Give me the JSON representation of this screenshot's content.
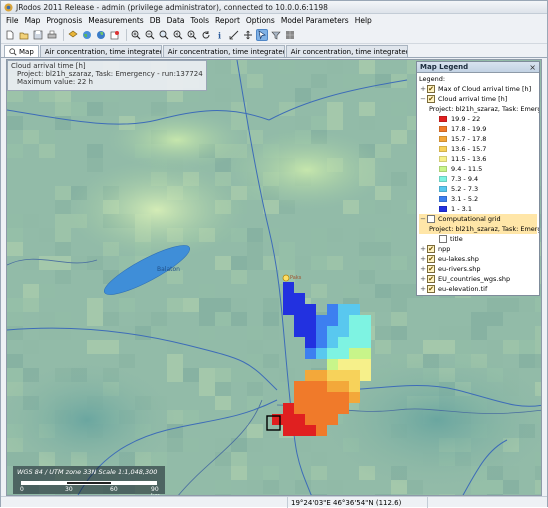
{
  "window": {
    "title": "JRodos 2011 Release - admin (privilege administrator), connected to 10.0.0.6:1198"
  },
  "menu": [
    "File",
    "Map",
    "Prognosis",
    "Measurements",
    "DB",
    "Data",
    "Tools",
    "Report",
    "Options",
    "Model Parameters",
    "Help"
  ],
  "toolbar_icons": [
    "new-icon",
    "open-icon",
    "save-icon",
    "print-icon",
    "layer-add-icon",
    "globe-icon",
    "globe-web-icon",
    "export-icon",
    "zoom-in-icon",
    "zoom-out-icon",
    "zoom-extent-icon",
    "zoom-prev-icon",
    "zoom-next-icon",
    "refresh-icon",
    "identify-icon",
    "measure-icon",
    "pan-icon",
    "select-icon",
    "filter-icon",
    "grid-icon"
  ],
  "tabs": [
    {
      "label": "Map",
      "selected": true
    },
    {
      "label": "Air concentration, time integrated n ...",
      "selected": false
    },
    {
      "label": "Air concentration, time integrated n ...",
      "selected": false
    },
    {
      "label": "Air concentration, time integrated n ...",
      "selected": false
    }
  ],
  "info_panel": {
    "title": "Cloud arrival time [h]",
    "project": "Project: bl21h_szaraz, Task: Emergency - run:1377242142983",
    "max": "Maximum value: 22 h"
  },
  "map_labels": {
    "lake": "Balaton"
  },
  "scale": {
    "text": "WGS 84 / UTM zone 33N    Scale 1:1,048,300",
    "ticks": [
      "0",
      "30",
      "60",
      "90 km"
    ]
  },
  "legend": {
    "title": "Map Legend",
    "close": "×",
    "heading": "Legend:",
    "items": [
      {
        "label": "Max of Cloud arrival time [h]",
        "checked": true
      },
      {
        "label": "Cloud arrival time [h]",
        "checked": true
      },
      {
        "label": "Project: bl21h_szaraz, Task: Emergency"
      }
    ],
    "classes": [
      {
        "label": "19.9 - 22",
        "color": "#e02020"
      },
      {
        "label": "17.8 - 19.9",
        "color": "#f07a2a"
      },
      {
        "label": "15.7 - 17.8",
        "color": "#f3a83a"
      },
      {
        "label": "13.6 - 15.7",
        "color": "#f7d25a"
      },
      {
        "label": "11.5 - 13.6",
        "color": "#f6f08a"
      },
      {
        "label": "9.4 - 11.5",
        "color": "#c8f58a"
      },
      {
        "label": "7.3 - 9.4",
        "color": "#7ef3e2"
      },
      {
        "label": "5.2 - 7.3",
        "color": "#59c8ef"
      },
      {
        "label": "3.1 - 5.2",
        "color": "#3d7ff0"
      },
      {
        "label": "1 - 3.1",
        "color": "#2231e0"
      }
    ],
    "grid": {
      "label": "Computational grid",
      "project": "Project: bl21h_szaraz, Task: Emergency",
      "title": "title"
    },
    "layers": [
      {
        "label": "npp",
        "checked": true
      },
      {
        "label": "eu-lakes.shp",
        "checked": true
      },
      {
        "label": "eu-rivers.shp",
        "checked": true
      },
      {
        "label": "EU_countries_wgs.shp",
        "checked": true
      },
      {
        "label": "eu-elevation.tif",
        "checked": true
      }
    ]
  },
  "status": {
    "coords": "19°24'03\"E 46°36'54\"N  (112.6)"
  },
  "colors": {
    "accent": "#7fb1e6",
    "lake": "#3f8ed8",
    "river": "#3d6cb8",
    "border": "#4a6fa0"
  }
}
